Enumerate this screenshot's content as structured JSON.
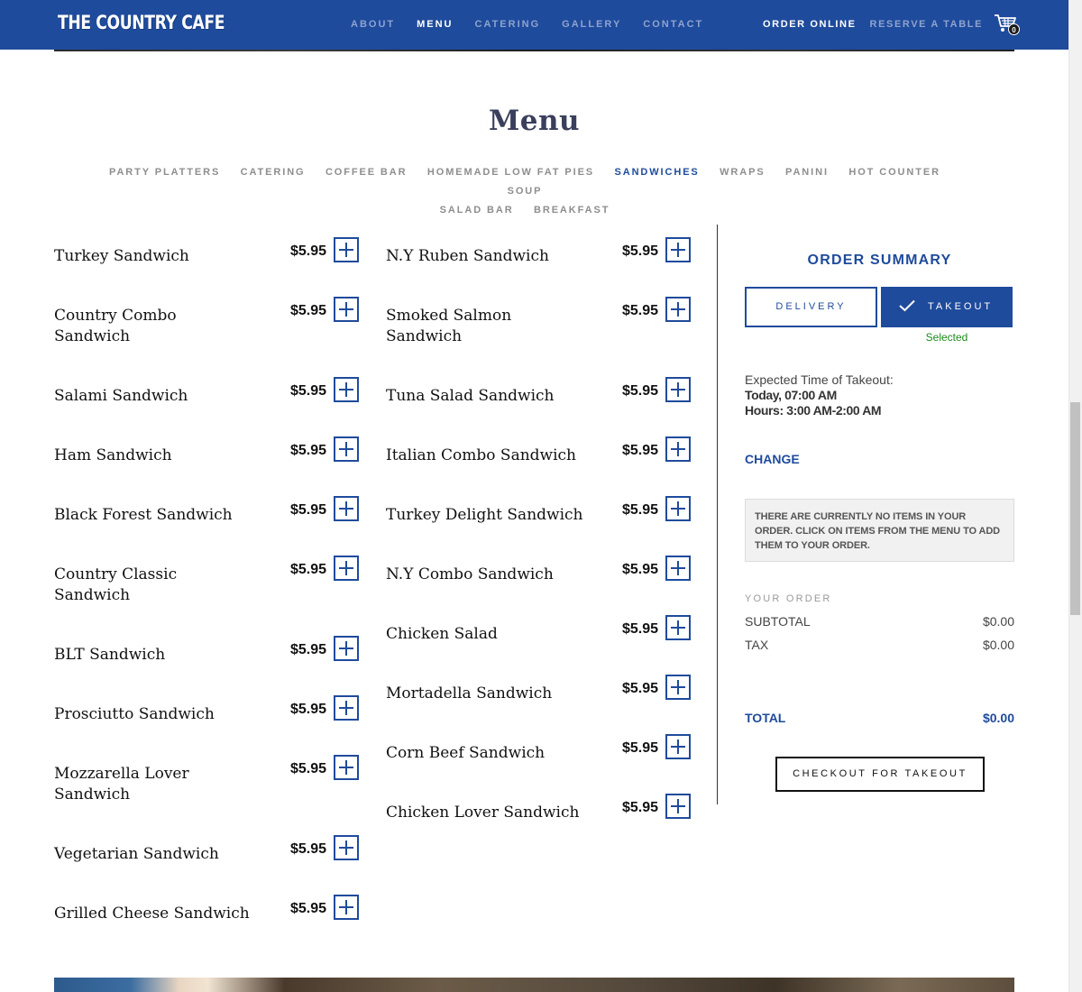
{
  "brand": {
    "logo_text": "THE COUNTRY CAFE"
  },
  "nav": {
    "items": [
      {
        "label": "ABOUT",
        "active": false
      },
      {
        "label": "MENU",
        "active": true
      },
      {
        "label": "CATERING",
        "active": false
      },
      {
        "label": "GALLERY",
        "active": false
      },
      {
        "label": "CONTACT",
        "active": false
      }
    ],
    "order_online": "ORDER ONLINE",
    "reserve": "RESERVE A TABLE",
    "cart_count": "0"
  },
  "menu": {
    "title": "Menu",
    "categories": [
      {
        "label": "PARTY PLATTERS",
        "active": false
      },
      {
        "label": "CATERING",
        "active": false
      },
      {
        "label": "COFFEE BAR",
        "active": false
      },
      {
        "label": "HOMEMADE LOW FAT PIES",
        "active": false
      },
      {
        "label": "SANDWICHES",
        "active": true
      },
      {
        "label": "WRAPS",
        "active": false
      },
      {
        "label": "PANINI",
        "active": false
      },
      {
        "label": "HOT COUNTER",
        "active": false
      },
      {
        "label": "SOUP",
        "active": false
      },
      {
        "label": "SALAD BAR",
        "active": false
      },
      {
        "label": "BREAKFAST",
        "active": false
      }
    ],
    "items_left": [
      {
        "name": "Turkey Sandwich",
        "price": "$5.95"
      },
      {
        "name": "Country Combo Sandwich",
        "price": "$5.95"
      },
      {
        "name": "Salami Sandwich",
        "price": "$5.95"
      },
      {
        "name": "Ham Sandwich",
        "price": "$5.95"
      },
      {
        "name": "Black Forest Sandwich",
        "price": "$5.95"
      },
      {
        "name": "Country Classic Sandwich",
        "price": "$5.95"
      },
      {
        "name": "BLT Sandwich",
        "price": "$5.95"
      },
      {
        "name": "Prosciutto Sandwich",
        "price": "$5.95"
      },
      {
        "name": "Mozzarella Lover Sandwich",
        "price": "$5.95"
      },
      {
        "name": "Vegetarian Sandwich",
        "price": "$5.95"
      },
      {
        "name": "Grilled Cheese Sandwich",
        "price": "$5.95"
      }
    ],
    "items_right": [
      {
        "name": "N.Y Ruben Sandwich",
        "price": "$5.95"
      },
      {
        "name": "Smoked Salmon Sandwich",
        "price": "$5.95"
      },
      {
        "name": "Tuna Salad Sandwich",
        "price": "$5.95"
      },
      {
        "name": "Italian Combo Sandwich",
        "price": "$5.95"
      },
      {
        "name": "Turkey Delight Sandwich",
        "price": "$5.95"
      },
      {
        "name": "N.Y Combo Sandwich",
        "price": "$5.95"
      },
      {
        "name": "Chicken Salad",
        "price": "$5.95"
      },
      {
        "name": "Mortadella Sandwich",
        "price": "$5.95"
      },
      {
        "name": "Corn Beef Sandwich",
        "price": "$5.95"
      },
      {
        "name": "Chicken Lover Sandwich",
        "price": "$5.95"
      }
    ]
  },
  "summary": {
    "title": "ORDER SUMMARY",
    "delivery_label": "DELIVERY",
    "takeout_label": "TAKEOUT",
    "selected_note": "Selected",
    "expected_label": "Expected Time of Takeout:",
    "expected_time": "Today, 07:00 AM",
    "hours": "Hours: 3:00 AM-2:00 AM",
    "change_label": "CHANGE",
    "empty_message": "There are currently no items in your order. Click on items from the menu to add them to your order.",
    "your_order_label": "YOUR ORDER",
    "subtotal_label": "SUBTOTAL",
    "subtotal_value": "$0.00",
    "tax_label": "TAX",
    "tax_value": "$0.00",
    "total_label": "TOTAL",
    "total_value": "$0.00",
    "checkout_label": "CHECKOUT FOR TAKEOUT"
  },
  "colors": {
    "brand_blue": "#1f4b9c",
    "nav_muted": "#8ea3cf",
    "selected_green": "#1c8a1c"
  }
}
